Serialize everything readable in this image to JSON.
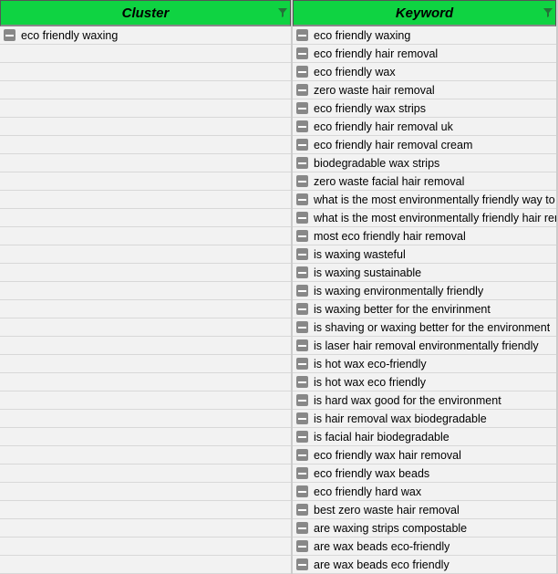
{
  "columns": {
    "cluster": {
      "header": "Cluster"
    },
    "keyword": {
      "header": "Keyword"
    }
  },
  "cluster_rows": [
    "eco friendly waxing"
  ],
  "keyword_rows": [
    "eco friendly waxing",
    "eco friendly hair removal",
    "eco friendly wax",
    "zero waste hair removal",
    "eco friendly wax strips",
    "eco friendly hair removal uk",
    "eco friendly hair removal cream",
    "biodegradable wax strips",
    "zero waste facial hair removal",
    "what is the most environmentally friendly way to r",
    "what is the most environmentally friendly hair rem",
    "most eco friendly hair removal",
    "is waxing wasteful",
    "is waxing sustainable",
    "is waxing environmentally friendly",
    "is waxing better for the envirinment",
    "is shaving or waxing better for the environment",
    "is laser hair removal environmentally friendly",
    "is hot wax eco-friendly",
    "is hot wax eco friendly",
    "is hard wax good for the environment",
    "is hair removal wax biodegradable",
    "is facial hair biodegradable",
    "eco friendly wax hair removal",
    "eco friendly wax beads",
    "eco friendly hard wax",
    "best zero waste hair removal",
    "are waxing strips compostable",
    "are wax beads eco-friendly",
    "are wax beads eco friendly"
  ],
  "total_rows": 30
}
